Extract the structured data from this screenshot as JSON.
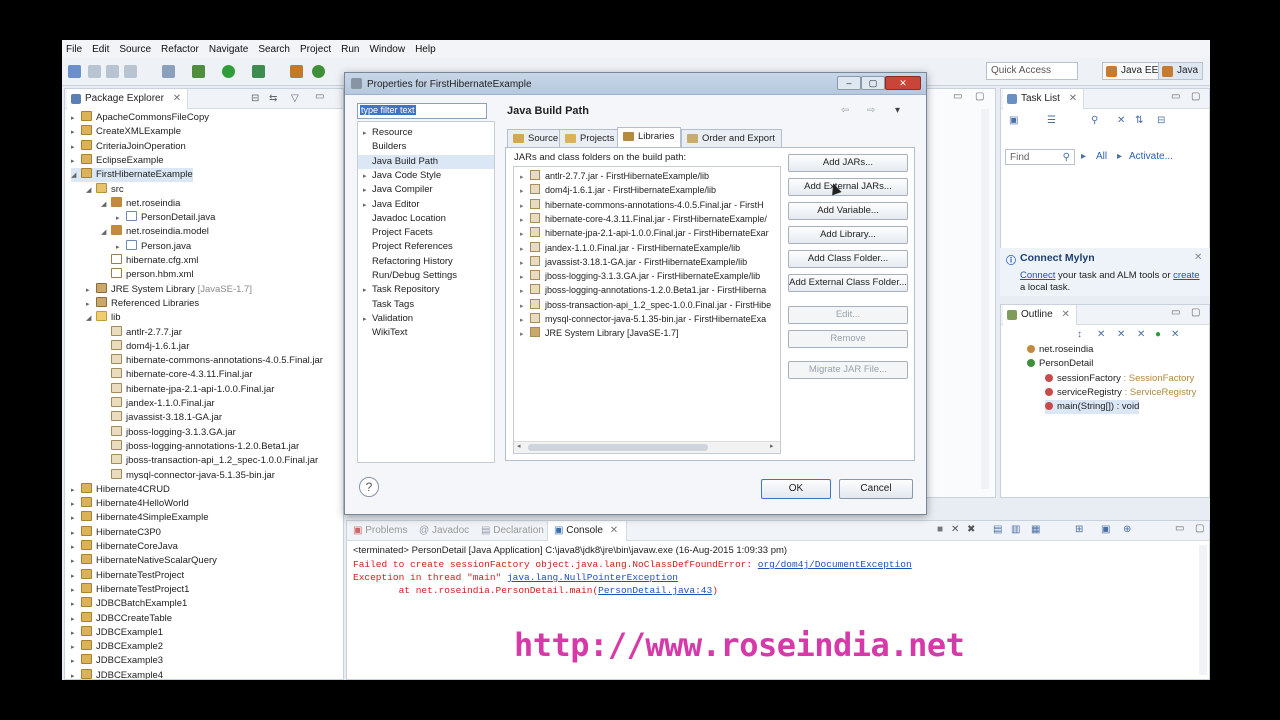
{
  "menubar": [
    "File",
    "Edit",
    "Source",
    "Refactor",
    "Navigate",
    "Search",
    "Project",
    "Run",
    "Window",
    "Help"
  ],
  "toolbar": {
    "quick_access": "Quick Access",
    "perspective_ee": "Java EE",
    "perspective_java": "Java"
  },
  "package_explorer": {
    "title": "Package Explorer",
    "rows": [
      {
        "label": "ApacheCommonsFileCopy",
        "indent": 0,
        "icon": "proj",
        "exp": "▸"
      },
      {
        "label": "CreateXMLExample",
        "indent": 0,
        "icon": "proj",
        "exp": "▸"
      },
      {
        "label": "CriteriaJoinOperation",
        "indent": 0,
        "icon": "proj",
        "exp": "▸"
      },
      {
        "label": "EclipseExample",
        "indent": 0,
        "icon": "proj",
        "exp": "▸"
      },
      {
        "label": "FirstHibernateExample",
        "indent": 0,
        "icon": "proj",
        "exp": "◢",
        "sel": true
      },
      {
        "label": "src",
        "indent": 1,
        "icon": "src",
        "exp": "◢"
      },
      {
        "label": "net.roseindia",
        "indent": 2,
        "icon": "pkg",
        "exp": "◢"
      },
      {
        "label": "PersonDetail.java",
        "indent": 3,
        "icon": "java",
        "exp": "▸"
      },
      {
        "label": "net.roseindia.model",
        "indent": 2,
        "icon": "pkg",
        "exp": "◢"
      },
      {
        "label": "Person.java",
        "indent": 3,
        "icon": "java",
        "exp": "▸"
      },
      {
        "label": "hibernate.cfg.xml",
        "indent": 2,
        "icon": "xml",
        "exp": ""
      },
      {
        "label": "person.hbm.xml",
        "indent": 2,
        "icon": "xml",
        "exp": ""
      },
      {
        "label": "JRE System Library",
        "suffix": " [JavaSE-1.7]",
        "indent": 1,
        "icon": "lib",
        "exp": "▸"
      },
      {
        "label": "Referenced Libraries",
        "indent": 1,
        "icon": "lib",
        "exp": "▸"
      },
      {
        "label": "lib",
        "indent": 1,
        "icon": "folder",
        "exp": "◢"
      },
      {
        "label": "antlr-2.7.7.jar",
        "indent": 2,
        "icon": "jar",
        "exp": ""
      },
      {
        "label": "dom4j-1.6.1.jar",
        "indent": 2,
        "icon": "jar",
        "exp": ""
      },
      {
        "label": "hibernate-commons-annotations-4.0.5.Final.jar",
        "indent": 2,
        "icon": "jar",
        "exp": ""
      },
      {
        "label": "hibernate-core-4.3.11.Final.jar",
        "indent": 2,
        "icon": "jar",
        "exp": ""
      },
      {
        "label": "hibernate-jpa-2.1-api-1.0.0.Final.jar",
        "indent": 2,
        "icon": "jar",
        "exp": ""
      },
      {
        "label": "jandex-1.1.0.Final.jar",
        "indent": 2,
        "icon": "jar",
        "exp": ""
      },
      {
        "label": "javassist-3.18.1-GA.jar",
        "indent": 2,
        "icon": "jar",
        "exp": ""
      },
      {
        "label": "jboss-logging-3.1.3.GA.jar",
        "indent": 2,
        "icon": "jar",
        "exp": ""
      },
      {
        "label": "jboss-logging-annotations-1.2.0.Beta1.jar",
        "indent": 2,
        "icon": "jar",
        "exp": ""
      },
      {
        "label": "jboss-transaction-api_1.2_spec-1.0.0.Final.jar",
        "indent": 2,
        "icon": "jar",
        "exp": ""
      },
      {
        "label": "mysql-connector-java-5.1.35-bin.jar",
        "indent": 2,
        "icon": "jar",
        "exp": ""
      },
      {
        "label": "Hibernate4CRUD",
        "indent": 0,
        "icon": "proj",
        "exp": "▸"
      },
      {
        "label": "Hibernate4HelloWorld",
        "indent": 0,
        "icon": "proj",
        "exp": "▸"
      },
      {
        "label": "Hibernate4SimpleExample",
        "indent": 0,
        "icon": "proj",
        "exp": "▸"
      },
      {
        "label": "HibernateC3P0",
        "indent": 0,
        "icon": "proj",
        "exp": "▸"
      },
      {
        "label": "HibernateCoreJava",
        "indent": 0,
        "icon": "proj",
        "exp": "▸"
      },
      {
        "label": "HibernateNativeScalarQuery",
        "indent": 0,
        "icon": "proj",
        "exp": "▸"
      },
      {
        "label": "HibernateTestProject",
        "indent": 0,
        "icon": "proj",
        "exp": "▸"
      },
      {
        "label": "HibernateTestProject1",
        "indent": 0,
        "icon": "proj",
        "exp": "▸"
      },
      {
        "label": "JDBCBatchExample1",
        "indent": 0,
        "icon": "proj",
        "exp": "▸"
      },
      {
        "label": "JDBCCreateTable",
        "indent": 0,
        "icon": "proj",
        "exp": "▸"
      },
      {
        "label": "JDBCExample1",
        "indent": 0,
        "icon": "proj",
        "exp": "▸"
      },
      {
        "label": "JDBCExample2",
        "indent": 0,
        "icon": "proj",
        "exp": "▸"
      },
      {
        "label": "JDBCExample3",
        "indent": 0,
        "icon": "proj",
        "exp": "▸"
      },
      {
        "label": "JDBCExample4",
        "indent": 0,
        "icon": "proj",
        "exp": "▸"
      }
    ]
  },
  "task_list": {
    "title": "Task List",
    "find_placeholder": "Find",
    "all": "All",
    "activate": "Activate..."
  },
  "mylyn": {
    "title": "Connect Mylyn",
    "connect": "Connect",
    "text1": " your task and ALM tools or",
    "create": "create",
    "text2": " a local task."
  },
  "outline": {
    "title": "Outline",
    "rows": [
      {
        "label": "net.roseindia",
        "type": "",
        "indent": 0
      },
      {
        "label": "PersonDetail",
        "type": "",
        "indent": 0
      },
      {
        "label": "sessionFactory",
        "type": " : SessionFactory",
        "indent": 1
      },
      {
        "label": "serviceRegistry",
        "type": " : ServiceRegistry",
        "indent": 1
      },
      {
        "label": "main(String[]) : void",
        "type": "",
        "indent": 1,
        "sel": true
      }
    ]
  },
  "console": {
    "tabs": [
      "Problems",
      "Javadoc",
      "Declaration",
      "Console"
    ],
    "terminated": "<terminated> PersonDetail [Java Application] C:\\java8\\jdk8\\jre\\bin\\javaw.exe (16-Aug-2015 1:09:33 pm)",
    "line1_text": "Failed to create sessionFactory object.java.lang.NoClassDefFoundError: ",
    "line1_link": "org/dom4j/DocumentException",
    "line2_text": "Exception in thread \"main\" ",
    "line2_link": "java.lang.NullPointerException",
    "line3_text": "\tat net.roseindia.PersonDetail.main(",
    "line3_link": "PersonDetail.java:43",
    "line3_end": ")"
  },
  "watermark": "http://www.roseindia.net",
  "dialog": {
    "title": "Properties for FirstHibernateExample",
    "filter_text": "type filter text",
    "left_items": [
      {
        "label": "Resource",
        "exp": "▸"
      },
      {
        "label": "Builders",
        "exp": ""
      },
      {
        "label": "Java Build Path",
        "exp": "",
        "sel": true
      },
      {
        "label": "Java Code Style",
        "exp": "▸"
      },
      {
        "label": "Java Compiler",
        "exp": "▸"
      },
      {
        "label": "Java Editor",
        "exp": "▸"
      },
      {
        "label": "Javadoc Location",
        "exp": ""
      },
      {
        "label": "Project Facets",
        "exp": ""
      },
      {
        "label": "Project References",
        "exp": ""
      },
      {
        "label": "Refactoring History",
        "exp": ""
      },
      {
        "label": "Run/Debug Settings",
        "exp": ""
      },
      {
        "label": "Task Repository",
        "exp": "▸"
      },
      {
        "label": "Task Tags",
        "exp": ""
      },
      {
        "label": "Validation",
        "exp": "▸"
      },
      {
        "label": "WikiText",
        "exp": ""
      }
    ],
    "page_title": "Java Build Path",
    "tabs": [
      "Source",
      "Projects",
      "Libraries",
      "Order and Export"
    ],
    "active_tab": "Libraries",
    "list_label": "JARs and class folders on the build path:",
    "jars": [
      "antlr-2.7.7.jar - FirstHibernateExample/lib",
      "dom4j-1.6.1.jar - FirstHibernateExample/lib",
      "hibernate-commons-annotations-4.0.5.Final.jar - FirstH",
      "hibernate-core-4.3.11.Final.jar - FirstHibernateExample/",
      "hibernate-jpa-2.1-api-1.0.0.Final.jar - FirstHibernateExar",
      "jandex-1.1.0.Final.jar - FirstHibernateExample/lib",
      "javassist-3.18.1-GA.jar - FirstHibernateExample/lib",
      "jboss-logging-3.1.3.GA.jar - FirstHibernateExample/lib",
      "jboss-logging-annotations-1.2.0.Beta1.jar - FirstHiberna",
      "jboss-transaction-api_1.2_spec-1.0.0.Final.jar - FirstHibe",
      "mysql-connector-java-5.1.35-bin.jar - FirstHibernateExa",
      "JRE System Library [JavaSE-1.7]"
    ],
    "buttons": [
      "Add JARs...",
      "Add External JARs...",
      "Add Variable...",
      "Add Library...",
      "Add Class Folder...",
      "Add External Class Folder..."
    ],
    "disabled_buttons": [
      "Edit...",
      "Remove",
      "Migrate JAR File..."
    ],
    "ok": "OK",
    "cancel": "Cancel"
  }
}
